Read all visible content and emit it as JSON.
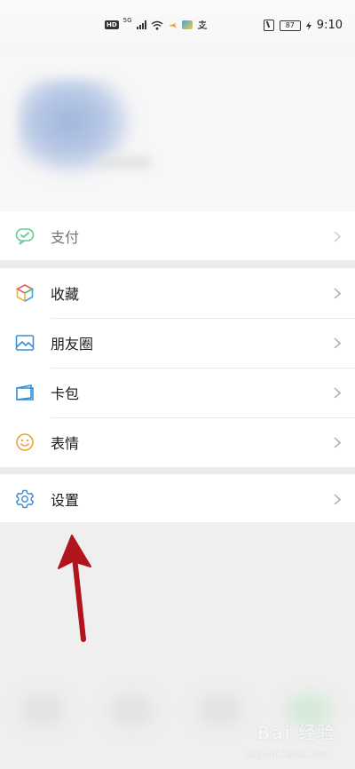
{
  "status_bar": {
    "left_badge": "HD",
    "network": "5G",
    "battery": "87",
    "time": "9:10",
    "icons": [
      "hd-icon",
      "signal-icon",
      "wifi-icon",
      "flight-icon",
      "app-notification-icon",
      "alipay-icon",
      "nfc-icon",
      "battery-icon",
      "charging-icon"
    ]
  },
  "menu": {
    "pay": {
      "label": "支付",
      "icon": "wechat-pay-icon"
    },
    "items": [
      {
        "label": "收藏",
        "icon": "favorites-cube-icon"
      },
      {
        "label": "朋友圈",
        "icon": "moments-picture-icon"
      },
      {
        "label": "卡包",
        "icon": "card-wallet-icon"
      },
      {
        "label": "表情",
        "icon": "smiley-icon"
      }
    ],
    "settings": {
      "label": "设置",
      "icon": "gear-icon"
    }
  },
  "annotation": {
    "arrow": "red-arrow-pointing-to-settings"
  },
  "watermark": {
    "text": "Bai 经验",
    "sub": "jingyan.baidu.com"
  },
  "colors": {
    "pay_green": "#3cb371",
    "settings_blue": "#4b8fd6",
    "favorites_multi": [
      "#e45b5b",
      "#f2b134",
      "#3aa7e0",
      "#5ac06d"
    ],
    "moments_blue": "#3a8fd9",
    "card_blue": "#2e8fd8",
    "smiley_orange": "#f0a13a",
    "arrow_red": "#b0141c",
    "separator": "#ececec"
  }
}
